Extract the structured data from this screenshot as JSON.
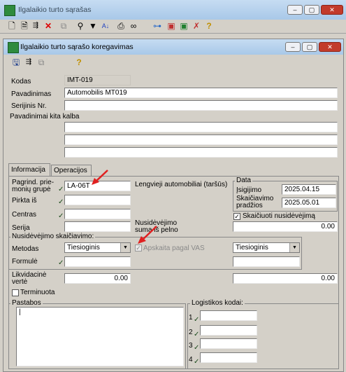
{
  "outer_window": {
    "title": "Ilgalaikio turto sąrašas"
  },
  "outer_toolbar": {
    "icons": [
      "new-icon",
      "document-icon",
      "filter-list-icon",
      "delete-icon",
      "copy-icon",
      "tree-icon",
      "funnel-icon",
      "sort-az-icon",
      "print-icon",
      "binoculars-icon",
      "network-icon",
      "cart-red-icon",
      "cart-green-icon",
      "tools-x-icon",
      "help-icon"
    ]
  },
  "dialog": {
    "title": "Ilgalaikio turto sąrašo koregavimas"
  },
  "dialog_toolbar": {
    "help_icon": "help-icon"
  },
  "form": {
    "kodas_label": "Kodas",
    "kodas_value": "IMT-019",
    "pavadinimas_label": "Pavadinimas",
    "pavadinimas_value": "Automobilis MT019",
    "serijinis_label": "Serijinis Nr.",
    "serijinis_value": "",
    "kita_kalba_label": "Pavadinimai kita kalba"
  },
  "tabs": [
    {
      "label": "Informacija"
    },
    {
      "label": "Operacijos"
    }
  ],
  "info": {
    "pagrind_label": "Pagrind. prie-monių grupė",
    "pagrind_value": "LA-06T",
    "group_name": "Lengvieji automobiliai (taršūs)",
    "pirkta_label": "Pirkta iš",
    "centras_label": "Centras",
    "serija_label": "Serija",
    "data_group_label": "Data",
    "isigijimo_label": "Įsigijimo",
    "isigijimo_value": "2025.04.15",
    "skaiciavimo_label": "Skaičiavimo pradžios",
    "skaiciavimo_value": "2025.05.01",
    "skaiciuoti_label": "Skaičiuoti nusidėvėjimą",
    "skaiciuoti_checked": true,
    "nusidevejimo_suma_label": "Nusidėvėjimo suma iš pelno",
    "nusidevejimo_suma_value": "0.00",
    "skaiciavimas_group_label": "Nusidėvėjimo skaičiavimo:",
    "metodas_label": "Metodas",
    "metodas_value": "Tiesioginis",
    "apskaita_label": "Apskaita pagal VAS",
    "apskaita_method_value": "Tiesioginis",
    "formule_label": "Formulė",
    "likvidacine_label": "Likvidacinė vertė",
    "likvidacine_value": "0.00",
    "likvidacine_vas_value": "0.00",
    "terminuota_label": "Terminuota",
    "pastabos_label": "Pastabos",
    "logistikos_label": "Logistikos kodai:",
    "logistikos_rows": [
      "1",
      "2",
      "3",
      "4"
    ]
  },
  "colors": {
    "title_bar": "#a8c8e8",
    "accent_arrow": "#e02020",
    "dialog_bg": "#d4d0c8"
  }
}
